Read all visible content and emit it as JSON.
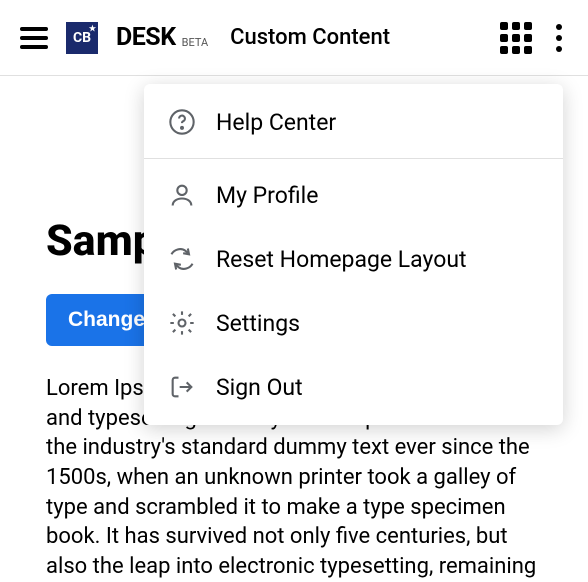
{
  "header": {
    "app_title": "DESK",
    "beta_label": "BETA",
    "breadcrumb": "Custom Content",
    "logo_text": "CB"
  },
  "page": {
    "heading": "Sampl",
    "button_label": "Change",
    "body_text": "Lorem Ipsum is simply dummy text of the printing and typesetting industry. Lorem Ipsum has been the industry's standard dummy text ever since the 1500s, when an unknown printer took a galley of type and scrambled it to make a type specimen book. It has survived not only five centuries, but also the leap into electronic typesetting, remaining"
  },
  "menu": {
    "items": [
      {
        "label": "Help Center",
        "icon": "help-icon"
      },
      {
        "label": "My Profile",
        "icon": "profile-icon"
      },
      {
        "label": "Reset Homepage Layout",
        "icon": "reset-icon"
      },
      {
        "label": "Settings",
        "icon": "settings-icon"
      },
      {
        "label": "Sign Out",
        "icon": "signout-icon"
      }
    ]
  }
}
